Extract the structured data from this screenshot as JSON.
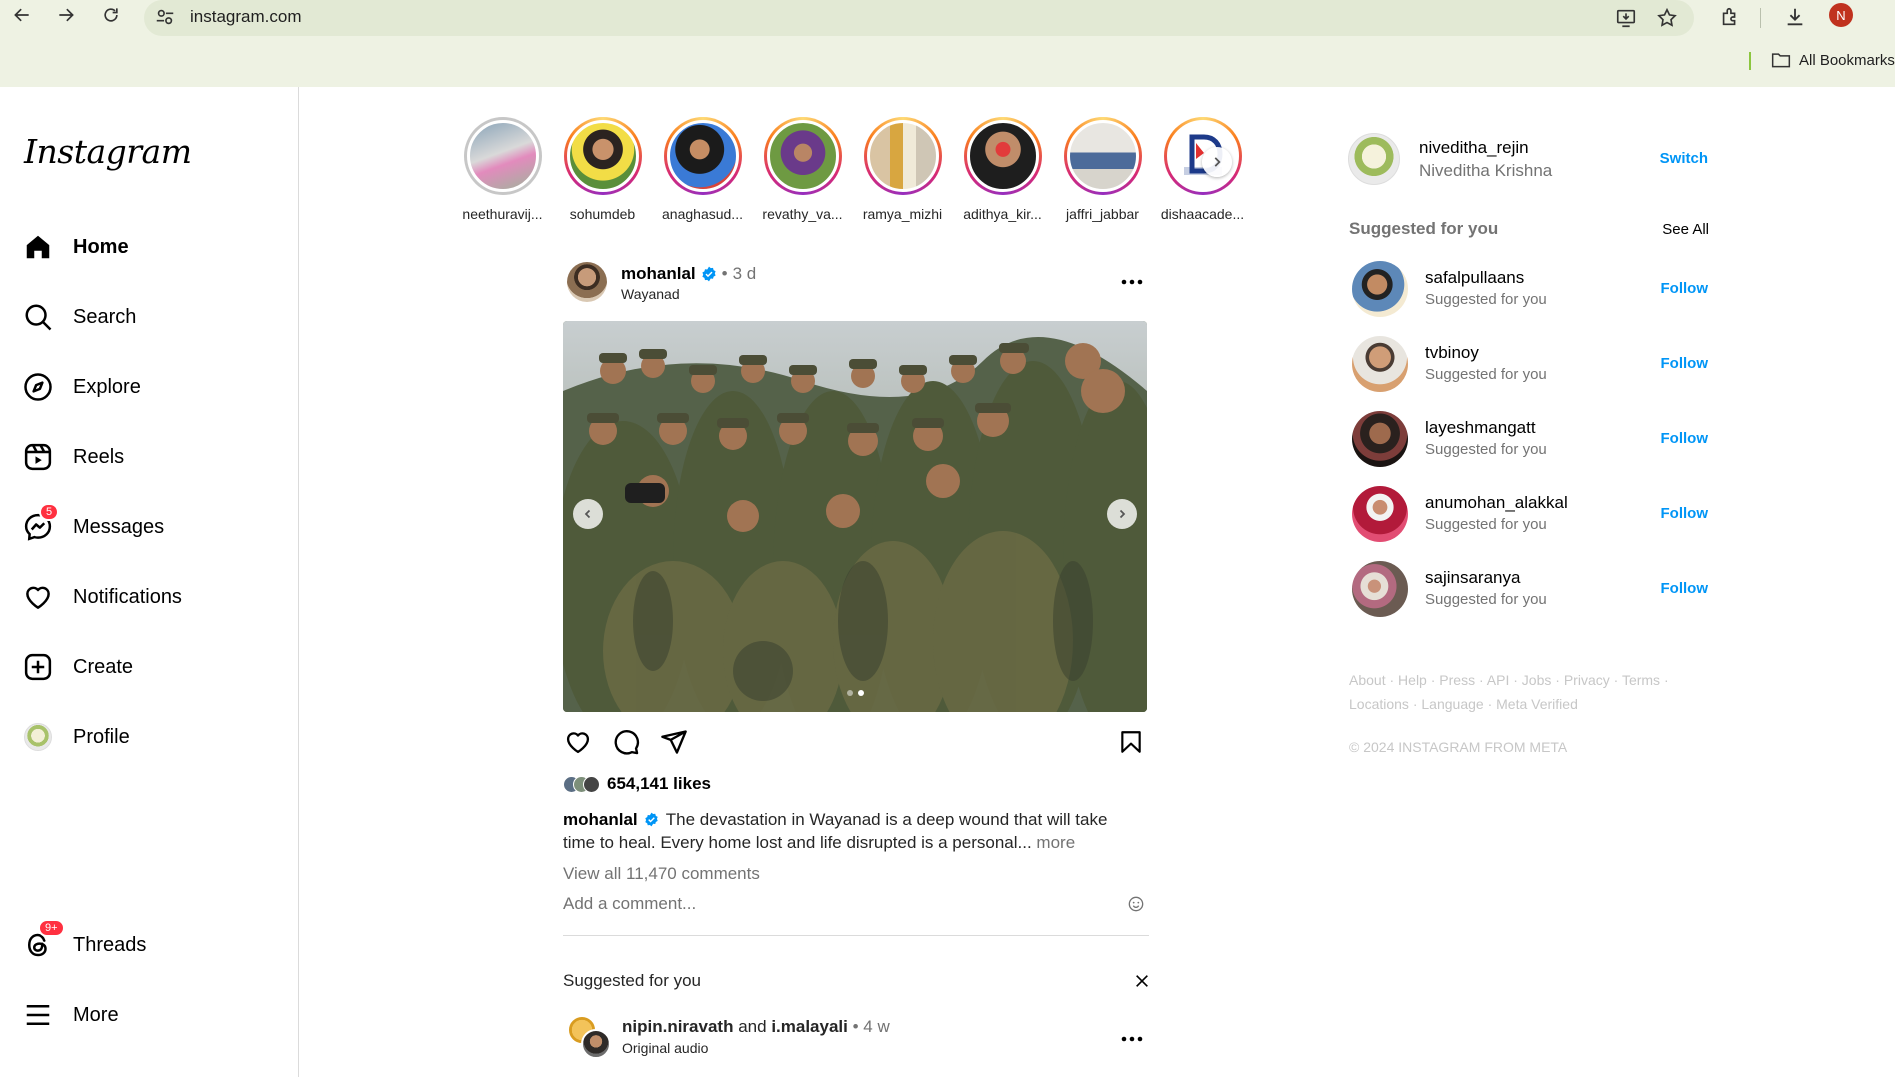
{
  "browser": {
    "url": "instagram.com",
    "profile_initial": "N",
    "bookmarks_label": "All Bookmarks"
  },
  "sidebar": {
    "logo": "Instagram",
    "items": [
      {
        "label": "Home",
        "icon": "home-icon"
      },
      {
        "label": "Search",
        "icon": "search-icon"
      },
      {
        "label": "Explore",
        "icon": "explore-icon"
      },
      {
        "label": "Reels",
        "icon": "reels-icon"
      },
      {
        "label": "Messages",
        "icon": "messenger-icon",
        "badge": "5"
      },
      {
        "label": "Notifications",
        "icon": "heart-icon"
      },
      {
        "label": "Create",
        "icon": "create-icon"
      },
      {
        "label": "Profile",
        "icon": "profile-avatar"
      },
      {
        "label": "Threads",
        "icon": "threads-icon",
        "badge": "9+"
      },
      {
        "label": "More",
        "icon": "menu-icon"
      }
    ]
  },
  "stories": [
    {
      "name": "neethuravij...",
      "seen": true
    },
    {
      "name": "sohumdeb",
      "seen": false
    },
    {
      "name": "anaghasud...",
      "seen": false
    },
    {
      "name": "revathy_va...",
      "seen": false
    },
    {
      "name": "ramya_mizhi",
      "seen": false
    },
    {
      "name": "adithya_kir...",
      "seen": false
    },
    {
      "name": "jaffri_jabbar",
      "seen": false
    },
    {
      "name": "dishaacade...",
      "seen": false
    }
  ],
  "post": {
    "username": "mohanlal",
    "time": "3 d",
    "time_sep": "•",
    "location": "Wayanad",
    "likes": "654,141 likes",
    "caption": "The devastation in Wayanad is a deep wound that will take time to heal. Every home lost and life disrupted is a personal...",
    "caption_more": "more",
    "view_comments": "View all 11,470 comments",
    "add_comment_placeholder": "Add a comment...",
    "carousel_dots": 2,
    "carousel_active": 1
  },
  "suggested_reel": {
    "title": "Suggested for you",
    "user1": "nipin.niravath",
    "and": "and",
    "user2": "i.malayali",
    "time": "4 w",
    "time_sep": "•",
    "audio": "Original audio"
  },
  "right": {
    "me": {
      "username": "niveditha_rejin",
      "full_name": "Niveditha Krishna",
      "switch": "Switch"
    },
    "suggested_title": "Suggested for you",
    "see_all": "See All",
    "suggestions": [
      {
        "username": "safalpullaans",
        "sub": "Suggested for you",
        "action": "Follow"
      },
      {
        "username": "tvbinoy",
        "sub": "Suggested for you",
        "action": "Follow"
      },
      {
        "username": "layeshmangatt",
        "sub": "Suggested for you",
        "action": "Follow"
      },
      {
        "username": "anumohan_alakkal",
        "sub": "Suggested for you",
        "action": "Follow"
      },
      {
        "username": "sajinsaranya",
        "sub": "Suggested for you",
        "action": "Follow"
      }
    ],
    "footer_links": [
      "About",
      "Help",
      "Press",
      "API",
      "Jobs",
      "Privacy",
      "Terms",
      "Locations",
      "Language",
      "Meta Verified"
    ],
    "copyright": "© 2024 INSTAGRAM FROM META"
  },
  "colors": {
    "accent_blue": "#0095f6",
    "badge_red": "#ff3040",
    "verified_blue": "#0095f6",
    "chrome_bg": "#eef2e3"
  }
}
